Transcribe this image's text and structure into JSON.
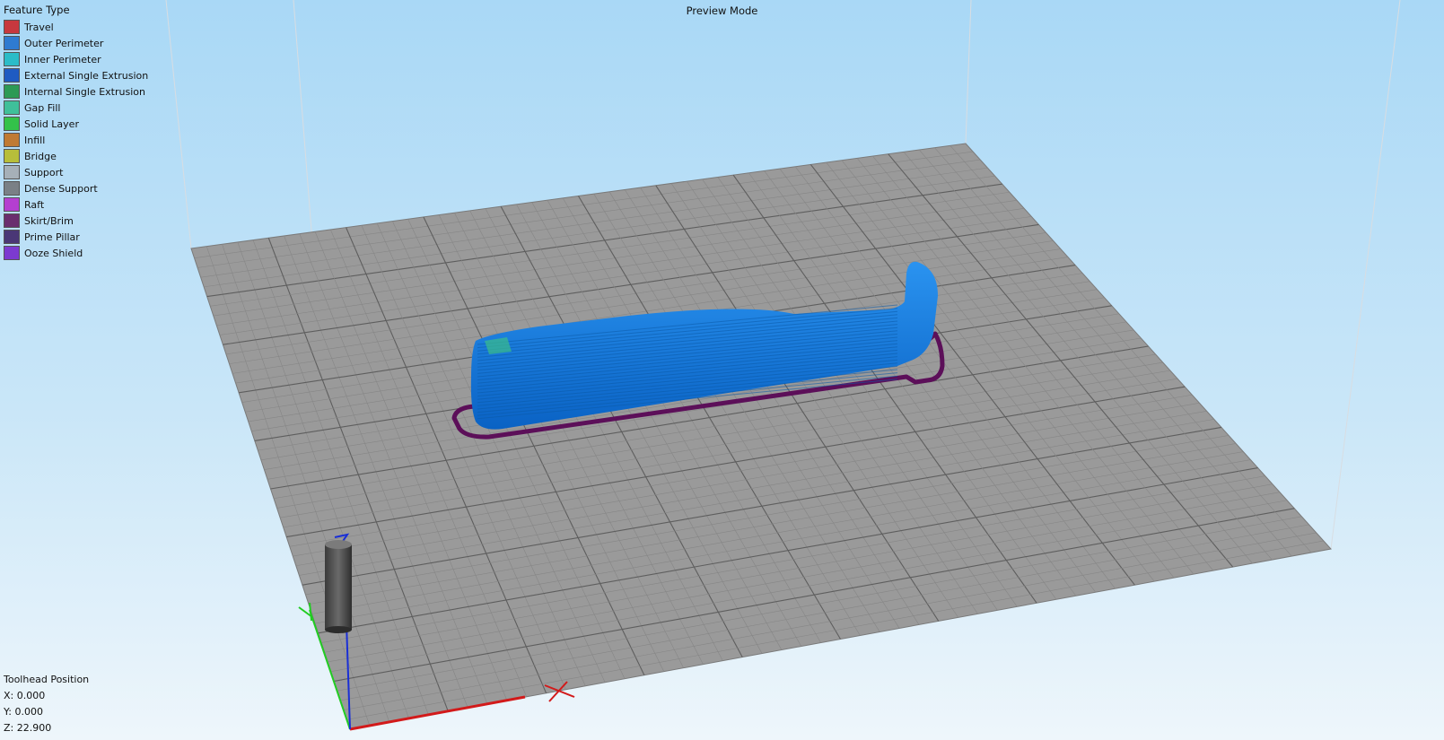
{
  "view": {
    "mode_label": "Preview Mode"
  },
  "legend": {
    "title": "Feature Type",
    "items": [
      {
        "label": "Travel",
        "color": "#c7383e"
      },
      {
        "label": "Outer Perimeter",
        "color": "#2f7bd0"
      },
      {
        "label": "Inner Perimeter",
        "color": "#2bbcc8"
      },
      {
        "label": "External Single Extrusion",
        "color": "#1f5bc2"
      },
      {
        "label": "Internal Single Extrusion",
        "color": "#2c9a55"
      },
      {
        "label": "Gap Fill",
        "color": "#3fc09a"
      },
      {
        "label": "Solid Layer",
        "color": "#33c24a"
      },
      {
        "label": "Infill",
        "color": "#c07a33"
      },
      {
        "label": "Bridge",
        "color": "#b7be3a"
      },
      {
        "label": "Support",
        "color": "#a6b0b8"
      },
      {
        "label": "Dense Support",
        "color": "#7a8086"
      },
      {
        "label": "Raft",
        "color": "#b43fd0"
      },
      {
        "label": "Skirt/Brim",
        "color": "#6a2e6e"
      },
      {
        "label": "Prime Pillar",
        "color": "#4a3776"
      },
      {
        "label": "Ooze Shield",
        "color": "#7c3ad0"
      }
    ]
  },
  "toolhead": {
    "title": "Toolhead Position",
    "x": "X: 0.000",
    "y": "Y: 0.000",
    "z": "Z: 22.900"
  },
  "colors": {
    "bed": "#9a9a9a",
    "grid_line": "#6e6e6e",
    "model": "#1478e0",
    "skirt": "#5c0f59",
    "axis_x": "#d21a1a",
    "axis_y": "#22cc22",
    "axis_z": "#1a2fd6"
  }
}
